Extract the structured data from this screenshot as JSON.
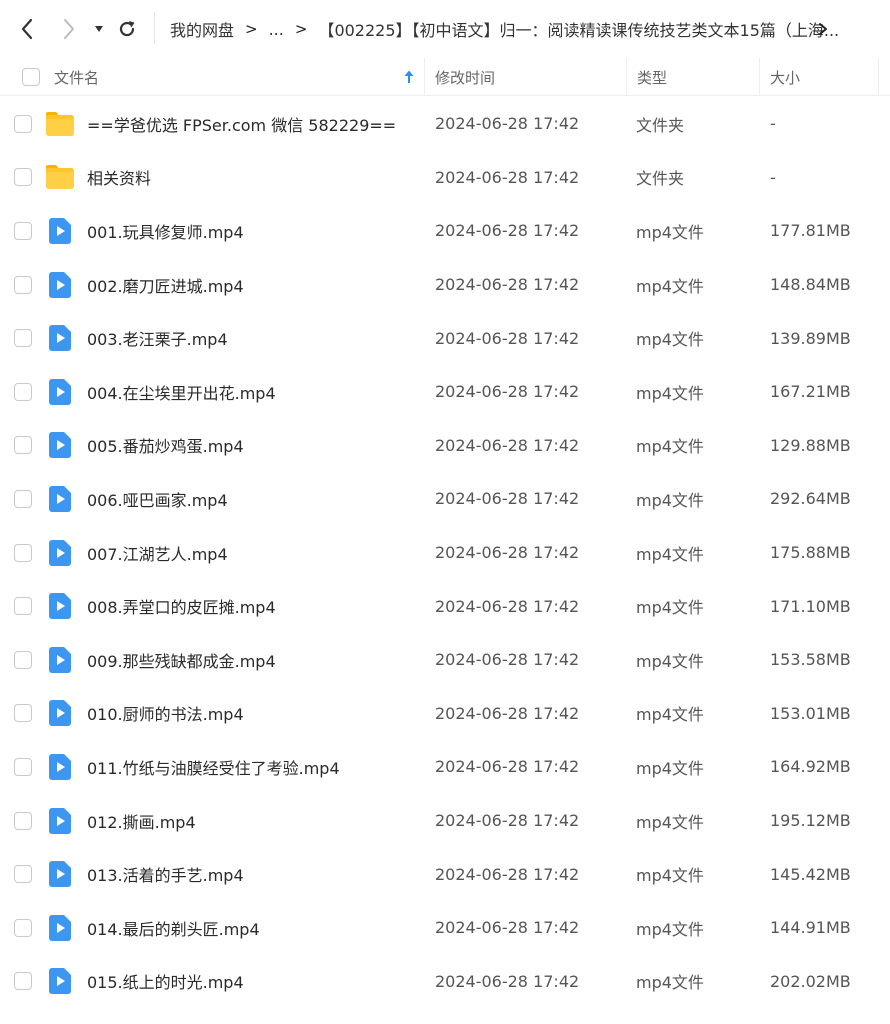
{
  "breadcrumb": {
    "root": "我的网盘",
    "ellipsis": "...",
    "current": "【002225】【初中语文】归一：阅读精读课传统技艺类文本15篇（上海..."
  },
  "columns": {
    "name": "文件名",
    "time": "修改时间",
    "type": "类型",
    "size": "大小"
  },
  "files": [
    {
      "kind": "folder",
      "name": "==学爸优选 FPSer.com 微信 582229==",
      "time": "2024-06-28 17:42",
      "type": "文件夹",
      "size": "-"
    },
    {
      "kind": "folder",
      "name": "相关资料",
      "time": "2024-06-28 17:42",
      "type": "文件夹",
      "size": "-"
    },
    {
      "kind": "video",
      "name": "001.玩具修复师.mp4",
      "time": "2024-06-28 17:42",
      "type": "mp4文件",
      "size": "177.81MB"
    },
    {
      "kind": "video",
      "name": "002.磨刀匠进城.mp4",
      "time": "2024-06-28 17:42",
      "type": "mp4文件",
      "size": "148.84MB"
    },
    {
      "kind": "video",
      "name": "003.老汪栗子.mp4",
      "time": "2024-06-28 17:42",
      "type": "mp4文件",
      "size": "139.89MB"
    },
    {
      "kind": "video",
      "name": "004.在尘埃里开出花.mp4",
      "time": "2024-06-28 17:42",
      "type": "mp4文件",
      "size": "167.21MB"
    },
    {
      "kind": "video",
      "name": "005.番茄炒鸡蛋.mp4",
      "time": "2024-06-28 17:42",
      "type": "mp4文件",
      "size": "129.88MB"
    },
    {
      "kind": "video",
      "name": "006.哑巴画家.mp4",
      "time": "2024-06-28 17:42",
      "type": "mp4文件",
      "size": "292.64MB"
    },
    {
      "kind": "video",
      "name": "007.江湖艺人.mp4",
      "time": "2024-06-28 17:42",
      "type": "mp4文件",
      "size": "175.88MB"
    },
    {
      "kind": "video",
      "name": "008.弄堂口的皮匠摊.mp4",
      "time": "2024-06-28 17:42",
      "type": "mp4文件",
      "size": "171.10MB"
    },
    {
      "kind": "video",
      "name": "009.那些残缺都成金.mp4",
      "time": "2024-06-28 17:42",
      "type": "mp4文件",
      "size": "153.58MB"
    },
    {
      "kind": "video",
      "name": "010.厨师的书法.mp4",
      "time": "2024-06-28 17:42",
      "type": "mp4文件",
      "size": "153.01MB"
    },
    {
      "kind": "video",
      "name": "011.竹纸与油膜经受住了考验.mp4",
      "time": "2024-06-28 17:42",
      "type": "mp4文件",
      "size": "164.92MB"
    },
    {
      "kind": "video",
      "name": "012.撕画.mp4",
      "time": "2024-06-28 17:42",
      "type": "mp4文件",
      "size": "195.12MB"
    },
    {
      "kind": "video",
      "name": "013.活着的手艺.mp4",
      "time": "2024-06-28 17:42",
      "type": "mp4文件",
      "size": "145.42MB"
    },
    {
      "kind": "video",
      "name": "014.最后的剃头匠.mp4",
      "time": "2024-06-28 17:42",
      "type": "mp4文件",
      "size": "144.91MB"
    },
    {
      "kind": "video",
      "name": "015.纸上的时光.mp4",
      "time": "2024-06-28 17:42",
      "type": "mp4文件",
      "size": "202.02MB"
    }
  ],
  "colors": {
    "folder": "#ffc52b",
    "video": "#3d97f0",
    "sort_arrow": "#2d8cf0"
  }
}
